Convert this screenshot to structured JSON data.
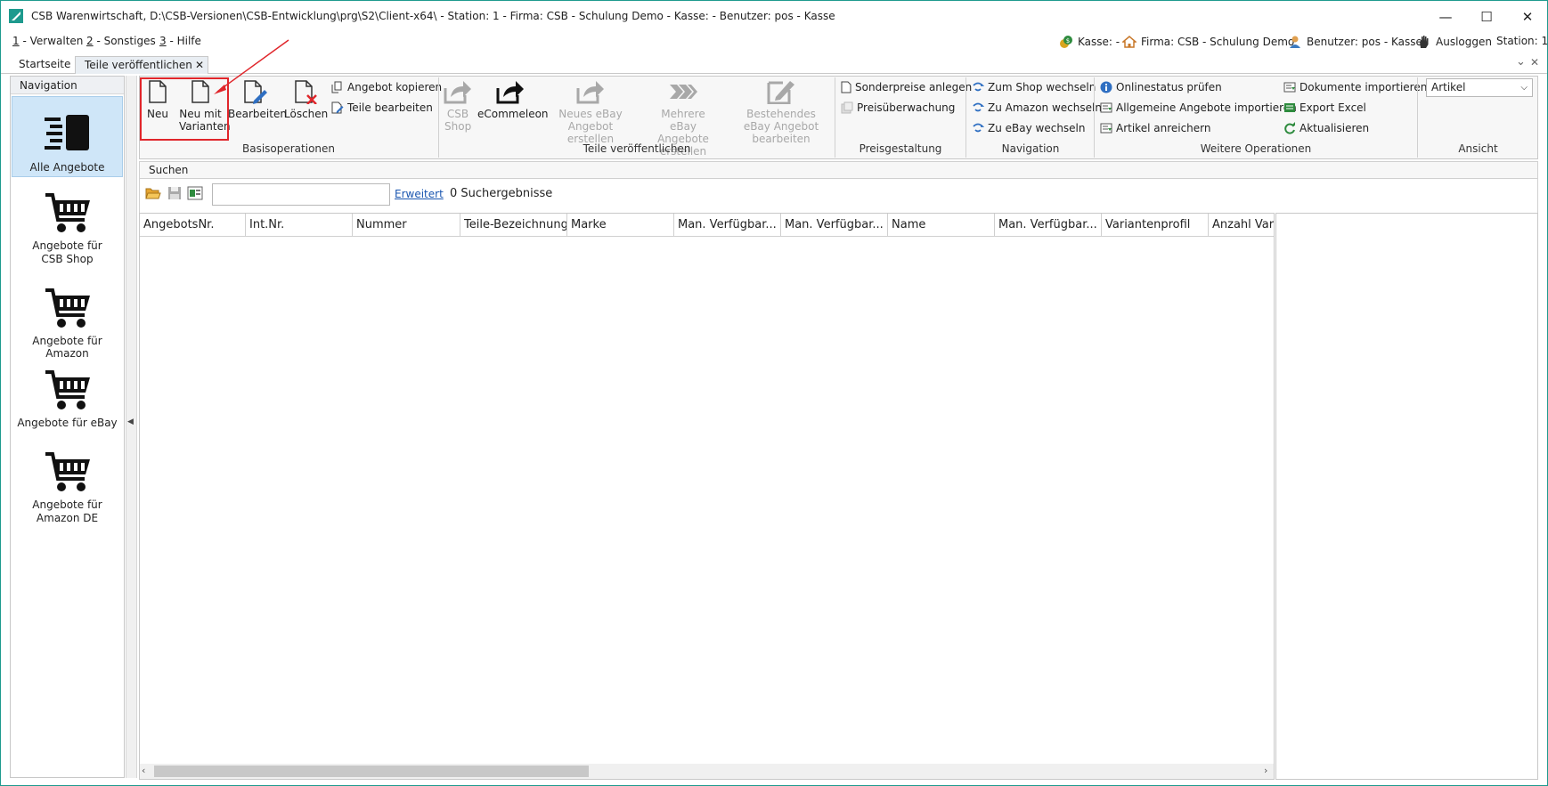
{
  "window": {
    "title": "CSB Warenwirtschaft, D:\\CSB-Versionen\\CSB-Entwicklung\\prg\\S2\\Client-x64\\ - Station: 1 - Firma: CSB - Schulung Demo - Kasse:  - Benutzer: pos - Kasse",
    "minimize": "—",
    "maximize": "☐",
    "close": "✕"
  },
  "menu": [
    {
      "key": "1",
      "label": " - Verwalten"
    },
    {
      "key": "2",
      "label": " - Sonstiges"
    },
    {
      "key": "3",
      "label": " - Hilfe"
    }
  ],
  "status": {
    "kasse": "Kasse: -",
    "firma": "Firma: CSB - Schulung Demo",
    "benutzer": "Benutzer: pos - Kasse",
    "ausloggen": "Ausloggen",
    "station": "Station: 1"
  },
  "tabs": {
    "start": "Startseite",
    "active": "Teile veröffentlichen",
    "close": "✕",
    "collapse": "⌄",
    "closeall": "✕"
  },
  "navigation": {
    "header": "Navigation",
    "items": [
      {
        "label": "Alle Angebote",
        "icon": "list-icon"
      },
      {
        "label": "Angebote für CSB Shop",
        "icon": "cart-icon"
      },
      {
        "label": "Angebote für Amazon",
        "icon": "cart-icon"
      },
      {
        "label": "Angebote für eBay",
        "icon": "cart-icon"
      },
      {
        "label": "Angebote für Amazon DE",
        "icon": "cart-icon"
      }
    ]
  },
  "ribbon": {
    "basis": {
      "group": "Basisoperationen",
      "neu": "Neu",
      "neu_mit_varianten": "Neu mit Varianten",
      "bearbeiten": "Bearbeiten",
      "loeschen": "Löschen",
      "angebot_kopieren": "Angebot kopieren",
      "teile_bearbeiten": "Teile bearbeiten"
    },
    "publish": {
      "group": "Teile veröffentlichen",
      "csb_shop": "CSB Shop",
      "ecommeleon": "eCommeleon",
      "neues_ebay": "Neues eBay Angebot erstellen",
      "mehrere_ebay": "Mehrere eBay Angebote erstellen",
      "bestehendes_ebay": "Bestehendes eBay Angebot bearbeiten"
    },
    "preis": {
      "group": "Preisgestaltung",
      "sonderpreise": "Sonderpreise anlegen",
      "preisueberwachung": "Preisüberwachung"
    },
    "nav": {
      "group": "Navigation",
      "shop": "Zum Shop wechseln",
      "amazon": "Zu Amazon wechseln",
      "ebay": "Zu eBay wechseln"
    },
    "weitere": {
      "group": "Weitere Operationen",
      "onlinestatus": "Onlinestatus prüfen",
      "allgemeine": "Allgemeine Angebote importieren",
      "anreichern": "Artikel anreichern",
      "dokumente": "Dokumente importieren",
      "excel": "Export Excel",
      "aktualisieren": "Aktualisieren"
    },
    "ansicht": {
      "group": "Ansicht",
      "selected": "Artikel"
    }
  },
  "search": {
    "header": "Suchen",
    "value": "",
    "erweitert": "Erweitert",
    "results": "0 Suchergebnisse"
  },
  "grid": {
    "columns": [
      "AngebotsNr.",
      "Int.Nr.",
      "Nummer",
      "Teile-Bezeichnung",
      "Marke",
      "Man. Verfügbar...",
      "Man. Verfügbar...",
      "Name",
      "Man. Verfügbar...",
      "Variantenprofil",
      "Anzahl Vari"
    ],
    "rows": []
  },
  "colors": {
    "accent": "#1e9a8e",
    "highlight": "#e0262b",
    "selection": "#cfe6f8"
  }
}
